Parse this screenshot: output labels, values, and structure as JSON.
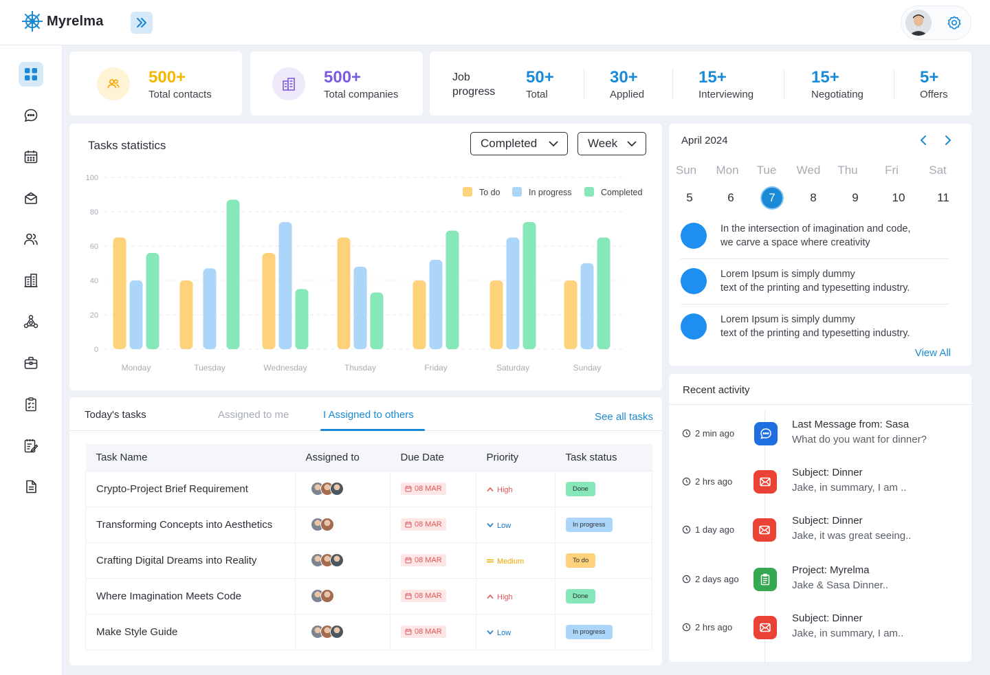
{
  "app": {
    "name": "Myrelma"
  },
  "stats": [
    {
      "value": "500+",
      "label": "Total contacts",
      "color": "#f5b800"
    },
    {
      "value": "500+",
      "label": "Total companies",
      "color": "#7b5ce0"
    }
  ],
  "job_progress": {
    "title": "Job progress",
    "items": [
      {
        "value": "50+",
        "label": "Total"
      },
      {
        "value": "30+",
        "label": "Applied"
      },
      {
        "value": "15+",
        "label": "Interviewing"
      },
      {
        "value": "15+",
        "label": "Negotiating"
      },
      {
        "value": "5+",
        "label": "Offers"
      }
    ]
  },
  "tasks_statistics": {
    "title": "Tasks statistics",
    "filter_status": "Completed",
    "filter_period": "Week"
  },
  "chart_data": {
    "type": "bar",
    "categories": [
      "Monday",
      "Tuesday",
      "Wednesday",
      "Thusday",
      "Friday",
      "Saturday",
      "Sunday"
    ],
    "series": [
      {
        "name": "To do",
        "color": "#fdd27a",
        "values": [
          65,
          40,
          56,
          65,
          40,
          40,
          40
        ]
      },
      {
        "name": "In progress",
        "color": "#acd6f9",
        "values": [
          40,
          47,
          74,
          48,
          52,
          65,
          50
        ]
      },
      {
        "name": "Completed",
        "color": "#86e7b8",
        "values": [
          56,
          87,
          35,
          33,
          69,
          74,
          65
        ]
      }
    ],
    "yticks": [
      "0",
      "20",
      "40",
      "60",
      "80",
      "100"
    ],
    "ylim": [
      0,
      100
    ],
    "legend": "top-right",
    "grid": true
  },
  "calendar": {
    "month": "April 2024",
    "dow": [
      "Sun",
      "Mon",
      "Tue",
      "Wed",
      "Thu",
      "Fri",
      "Sat"
    ],
    "days": [
      "5",
      "6",
      "7",
      "8",
      "9",
      "10",
      "11"
    ],
    "selected_index": 2,
    "events": [
      {
        "line1": "In the intersection of imagination and code,",
        "line2": "we carve a space where creativity"
      },
      {
        "line1": "Lorem Ipsum is simply dummy",
        "line2": "text of the printing and typesetting industry."
      },
      {
        "line1": "Lorem Ipsum is simply dummy",
        "line2": "text of the printing and typesetting industry."
      }
    ],
    "view_all": "View All"
  },
  "tasks": {
    "tabs": [
      "Today's tasks",
      "Assigned to me",
      "I Assigned to others"
    ],
    "active_tab": 2,
    "see_all": "See all tasks",
    "columns": [
      "Task Name",
      "Assigned to",
      "Due Date",
      "Priority",
      "Task status"
    ],
    "rows": [
      {
        "name": "Crypto-Project Brief Requirement",
        "avatars": 3,
        "due": "08 MAR",
        "priority": "High",
        "status": "Done"
      },
      {
        "name": "Transforming Concepts into Aesthetics",
        "avatars": 2,
        "due": "08 MAR",
        "priority": "Low",
        "status": "In progress"
      },
      {
        "name": "Crafting Digital Dreams into Reality",
        "avatars": 3,
        "due": "08 MAR",
        "priority": "Medium",
        "status": "To do"
      },
      {
        "name": "Where Imagination Meets Code",
        "avatars": 2,
        "due": "08 MAR",
        "priority": "High",
        "status": "Done"
      },
      {
        "name": "Make Style Guide",
        "avatars": 3,
        "due": "08 MAR",
        "priority": "Low",
        "status": "In progress"
      }
    ]
  },
  "recent_activity": {
    "title": "Recent activity",
    "items": [
      {
        "time": "2 min ago",
        "icon": "chat-icon",
        "color": "#1f6fe0",
        "head": "Last Message from: Sasa",
        "sub": "What do you want for dinner?"
      },
      {
        "time": "2 hrs ago",
        "icon": "mail-icon",
        "color": "#ea4335",
        "head": "Subject: Dinner",
        "sub": "Jake, in summary, I am .."
      },
      {
        "time": "1 day ago",
        "icon": "mail-icon",
        "color": "#ea4335",
        "head": "Subject: Dinner",
        "sub": "Jake, it was great seeing.."
      },
      {
        "time": "2 days ago",
        "icon": "clipboard-icon",
        "color": "#34a853",
        "head": "Project: Myrelma",
        "sub": "Jake & Sasa Dinner.."
      },
      {
        "time": "2 hrs ago",
        "icon": "mail-icon",
        "color": "#ea4335",
        "head": "Subject: Dinner",
        "sub": "Jake, in summary, I am.."
      }
    ]
  }
}
